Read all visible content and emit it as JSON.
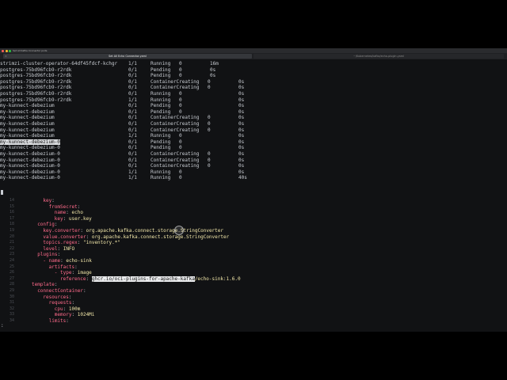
{
  "window": {
    "title": "Set All Kafka Connector pods",
    "tabs": [
      {
        "label": "Set All Echo Connector.yaml",
        "active": true
      },
      {
        "label": "~/Kubernetes/kafka/echo-plugin.yaml",
        "active": false
      }
    ]
  },
  "terminal": {
    "pods": [
      {
        "name": "strimzi-cluster-operator-64df45fdcf-kchgr",
        "ready": "1/1",
        "status": "Running",
        "restarts": "0",
        "age": "16m",
        "highlight": false
      },
      {
        "name": "postgres-75bd96fcb9-r2rdk",
        "ready": "0/1",
        "status": "Pending",
        "restarts": "0",
        "age": "0s",
        "highlight": false
      },
      {
        "name": "postgres-75bd96fcb9-r2rdk",
        "ready": "0/1",
        "status": "Pending",
        "restarts": "0",
        "age": "0s",
        "highlight": false
      },
      {
        "name": "postgres-75bd96fcb9-r2rdk",
        "ready": "0/1",
        "status": "ContainerCreating",
        "restarts": "0",
        "age": "0s",
        "highlight": false
      },
      {
        "name": "postgres-75bd96fcb9-r2rdk",
        "ready": "0/1",
        "status": "ContainerCreating",
        "restarts": "0",
        "age": "0s",
        "highlight": false
      },
      {
        "name": "postgres-75bd96fcb9-r2rdk",
        "ready": "0/1",
        "status": "Running",
        "restarts": "0",
        "age": "0s",
        "highlight": false
      },
      {
        "name": "postgres-75bd96fcb9-r2rdk",
        "ready": "1/1",
        "status": "Running",
        "restarts": "0",
        "age": "0s",
        "highlight": false
      },
      {
        "name": "my-kunnect-debezium",
        "ready": "0/1",
        "status": "Pending",
        "restarts": "0",
        "age": "0s",
        "highlight": false
      },
      {
        "name": "my-kunnect-debezium",
        "ready": "0/1",
        "status": "Pending",
        "restarts": "0",
        "age": "0s",
        "highlight": false
      },
      {
        "name": "my-kunnect-debezium",
        "ready": "0/1",
        "status": "ContainerCreating",
        "restarts": "0",
        "age": "0s",
        "highlight": false
      },
      {
        "name": "my-kunnect-debezium",
        "ready": "0/1",
        "status": "ContainerCreating",
        "restarts": "0",
        "age": "0s",
        "highlight": false
      },
      {
        "name": "my-kunnect-debezium",
        "ready": "0/1",
        "status": "ContainerCreating",
        "restarts": "0",
        "age": "0s",
        "highlight": false
      },
      {
        "name": "my-kunnect-debezium",
        "ready": "1/1",
        "status": "Running",
        "restarts": "0",
        "age": "0s",
        "highlight": false
      },
      {
        "name": "my-kunnect-debezium-0",
        "ready": "0/1",
        "status": "Pending",
        "restarts": "0",
        "age": "0s",
        "highlight": true
      },
      {
        "name": "my-kunnect-debezium-0",
        "ready": "0/1",
        "status": "Pending",
        "restarts": "0",
        "age": "0s",
        "highlight": false
      },
      {
        "name": "my-kunnect-debezium-0",
        "ready": "0/1",
        "status": "ContainerCreating",
        "restarts": "0",
        "age": "0s",
        "highlight": false
      },
      {
        "name": "my-kunnect-debezium-0",
        "ready": "0/1",
        "status": "ContainerCreating",
        "restarts": "0",
        "age": "0s",
        "highlight": false
      },
      {
        "name": "my-kunnect-debezium-0",
        "ready": "0/1",
        "status": "ContainerCreating",
        "restarts": "0",
        "age": "0s",
        "highlight": false
      },
      {
        "name": "my-kunnect-debezium-0",
        "ready": "1/1",
        "status": "Running",
        "restarts": "0",
        "age": "0s",
        "highlight": false
      },
      {
        "name": "my-kunnect-debezium-0",
        "ready": "1/1",
        "status": "Running",
        "restarts": "0",
        "age": "40s",
        "highlight": false
      }
    ]
  },
  "editor": {
    "lines": [
      {
        "n": "14",
        "indent": 2,
        "key": "key",
        "sep": ":",
        "value": ""
      },
      {
        "n": "15",
        "indent": 3,
        "key": "fromSecret",
        "sep": ":",
        "value": ""
      },
      {
        "n": "16",
        "indent": 4,
        "key": "name",
        "sep": ":",
        "value": "echo"
      },
      {
        "n": "17",
        "indent": 4,
        "key": "key",
        "sep": ":",
        "value": "user.key"
      },
      {
        "n": "18",
        "indent": 1,
        "key": "config",
        "sep": ":",
        "value": ""
      },
      {
        "n": "19",
        "indent": 2,
        "key": "key.converter",
        "sep": ":",
        "value": "org.apache.kafka.connect.storage.StringConverter"
      },
      {
        "n": "20",
        "indent": 2,
        "key": "value.converter",
        "sep": ":",
        "value": "org.apache.kafka.connect.storage.StringConverter"
      },
      {
        "n": "21",
        "indent": 2,
        "key": "topics.regex",
        "sep": ":",
        "value": "\"inventory.*\""
      },
      {
        "n": "22",
        "indent": 2,
        "key": "level",
        "sep": ":",
        "value": "INFO"
      },
      {
        "n": "23",
        "indent": 1,
        "key": "plugins",
        "sep": ":",
        "value": ""
      },
      {
        "n": "24",
        "indent": 2,
        "key": "- name",
        "sep": ":",
        "value": "echo-sink"
      },
      {
        "n": "25",
        "indent": 3,
        "key": "artifacts",
        "sep": ":",
        "value": ""
      },
      {
        "n": "26",
        "indent": 4,
        "key": "- type",
        "sep": ":",
        "value": "image"
      },
      {
        "n": "27",
        "indent": 5,
        "key": "reference",
        "sep": ":",
        "value": "",
        "sel": "ghcr.io/oci-plugins-for-apache-kafka",
        "rest": "/echo-sink:1.6.0"
      },
      {
        "n": "28",
        "indent": 0,
        "key": "template",
        "sep": ":",
        "value": ""
      },
      {
        "n": "29",
        "indent": 1,
        "key": "connectContainer",
        "sep": ":",
        "value": ""
      },
      {
        "n": "30",
        "indent": 2,
        "key": "resources",
        "sep": ":",
        "value": ""
      },
      {
        "n": "31",
        "indent": 3,
        "key": "requests",
        "sep": ":",
        "value": ""
      },
      {
        "n": "32",
        "indent": 4,
        "key": "cpu",
        "sep": ":",
        "value": "100m"
      },
      {
        "n": "33",
        "indent": 4,
        "key": "memory",
        "sep": ":",
        "value": "1024Mi"
      },
      {
        "n": "34",
        "indent": 3,
        "key": "limits",
        "sep": ":",
        "value": ""
      }
    ],
    "prompt": ":"
  }
}
